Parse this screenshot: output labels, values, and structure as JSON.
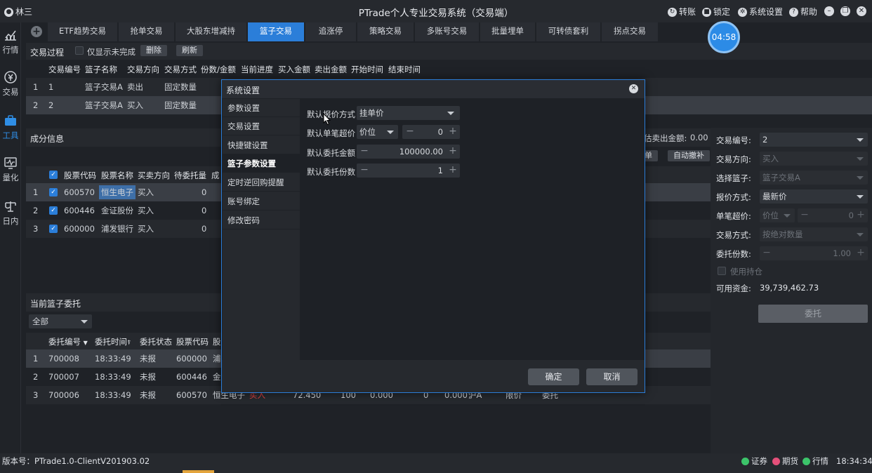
{
  "window": {
    "user": "林三",
    "title": "PTrade个人专业交易系统（交易端）",
    "buttons": {
      "transfer": "转账",
      "lock": "锁定",
      "settings": "系统设置",
      "help": "帮助"
    }
  },
  "nav": [
    {
      "label": "行情",
      "icon": "chart-icon"
    },
    {
      "label": "交易",
      "icon": "trade-icon"
    },
    {
      "label": "工具",
      "icon": "briefcase-icon",
      "active": true
    },
    {
      "label": "量化",
      "icon": "monitor-icon"
    },
    {
      "label": "日内",
      "icon": "scale-icon"
    }
  ],
  "tabs": [
    "ETF趋势交易",
    "抢单交易",
    "大股东增减持",
    "篮子交易",
    "追涨停",
    "策略交易",
    "多账号交易",
    "批量埋单",
    "可转债套利",
    "拐点交易"
  ],
  "active_tab": "篮子交易",
  "timer": "04:58",
  "process": {
    "title": "交易过程",
    "only_unfinished": "仅显示未完成",
    "delete": "删除",
    "refresh": "刷新",
    "columns": [
      "交易编号",
      "篮子名称",
      "交易方向",
      "交易方式",
      "份数/金额",
      "当前进度",
      "买入金额",
      "卖出金额",
      "开始时间",
      "结束时间"
    ],
    "rows": [
      {
        "idx": "1",
        "no": "1",
        "name": "篮子交易A",
        "dir": "卖出",
        "mode": "固定数量"
      },
      {
        "idx": "2",
        "no": "2",
        "name": "篮子交易A",
        "dir": "买入",
        "mode": "固定数量"
      }
    ]
  },
  "components": {
    "title": "成分信息",
    "est_sell_label": "估卖出金额:",
    "est_sell_value": "0.00",
    "btn_partial": "单",
    "btn_auto": "自动撤补",
    "columns": [
      "股票代码",
      "股票名称",
      "买卖方向",
      "待委托量",
      "成"
    ],
    "rows": [
      {
        "idx": "1",
        "code": "600570",
        "name": "恒生电子",
        "dir": "买入",
        "qty": "0"
      },
      {
        "idx": "2",
        "code": "600446",
        "name": "金证股份",
        "dir": "买入",
        "qty": "0"
      },
      {
        "idx": "3",
        "code": "600000",
        "name": "浦发银行",
        "dir": "买入",
        "qty": "0"
      }
    ]
  },
  "orders": {
    "title": "当前篮子委托",
    "filter": "全部",
    "columns": [
      "委托编号",
      "委托时间",
      "委托状态",
      "股票代码",
      "股"
    ],
    "rows": [
      {
        "idx": "1",
        "no": "700008",
        "time": "18:33:49",
        "status": "未报",
        "code": "600000",
        "name": "浦",
        "dir": "",
        "price": "",
        "qty": "",
        "amt": "",
        "filled": "",
        "avg": "",
        "mkt": "",
        "ptype": "",
        "op": ""
      },
      {
        "idx": "2",
        "no": "700007",
        "time": "18:33:49",
        "status": "未报",
        "code": "600446",
        "name": "金",
        "dir": "",
        "price": "",
        "qty": "",
        "amt": "",
        "filled": "",
        "avg": "",
        "mkt": "",
        "ptype": "",
        "op": ""
      },
      {
        "idx": "3",
        "no": "700006",
        "time": "18:33:49",
        "status": "未报",
        "code": "600570",
        "name": "恒生电子",
        "dir": "买入",
        "price": "72.450",
        "qty": "100",
        "amt": "0.000",
        "filled": "0",
        "avg": "0.000",
        "mkt": "沪A",
        "ptype": "限价",
        "op": "委托"
      }
    ]
  },
  "right": {
    "trade_no_label": "交易编号:",
    "trade_no": "2",
    "dir_label": "交易方向:",
    "dir": "买入",
    "basket_label": "选择篮子:",
    "basket": "篮子交易A",
    "price_mode_label": "报价方式:",
    "price_mode": "最新价",
    "over_label": "单笔超价:",
    "over_unit": "价位",
    "over_value": "0",
    "trade_mode_label": "交易方式:",
    "trade_mode": "按绝对数量",
    "copies_label": "委托份数:",
    "copies": "1.00",
    "use_hold": "使用持仓",
    "funds_label": "可用资金:",
    "funds": "39,739,462.73",
    "submit": "委托"
  },
  "status": {
    "version": "版本号：PTrade1.0-ClientV201903.02",
    "sec": "证券",
    "fut": "期货",
    "quote": "行情",
    "time": "18:34:34",
    "colors": {
      "sec": "#3cc46a",
      "fut": "#e5507a",
      "quote": "#3cc46a"
    }
  },
  "modal": {
    "title": "系统设置",
    "menu": [
      "参数设置",
      "交易设置",
      "快捷键设置",
      "篮子参数设置",
      "定时逆回购提醒",
      "账号绑定",
      "修改密码"
    ],
    "active": "篮子参数设置",
    "fields": {
      "price_mode_label": "默认报价方式",
      "price_mode": "挂单价",
      "over_label": "默认单笔超价",
      "over_unit": "价位",
      "over_value": "0",
      "amount_label": "默认委托金额",
      "amount": "100000.00",
      "copies_label": "默认委托份数",
      "copies": "1"
    },
    "ok": "确定",
    "cancel": "取消"
  }
}
